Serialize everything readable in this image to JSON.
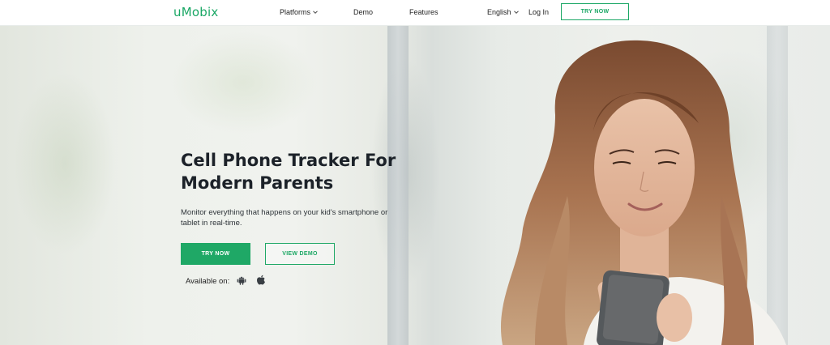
{
  "nav": {
    "logo": "uMobix",
    "links": [
      {
        "label": "Platforms",
        "dropdown": true
      },
      {
        "label": "Demo",
        "dropdown": false
      },
      {
        "label": "Features",
        "dropdown": false
      }
    ],
    "language": "English",
    "login": "Log In",
    "cta": "TRY NOW"
  },
  "hero": {
    "title_line1": "Cell Phone Tracker For",
    "title_line2": "Modern Parents",
    "subtitle": "Monitor everything that happens on your kid's smartphone or tablet in real-time.",
    "primary_button": "TRY NOW",
    "secondary_button": "VIEW DEMO",
    "available_label": "Available on:",
    "platform_icons": [
      "android-icon",
      "apple-icon"
    ]
  },
  "colors": {
    "brand_green": "#1fa866",
    "text_dark": "#1c2229"
  }
}
